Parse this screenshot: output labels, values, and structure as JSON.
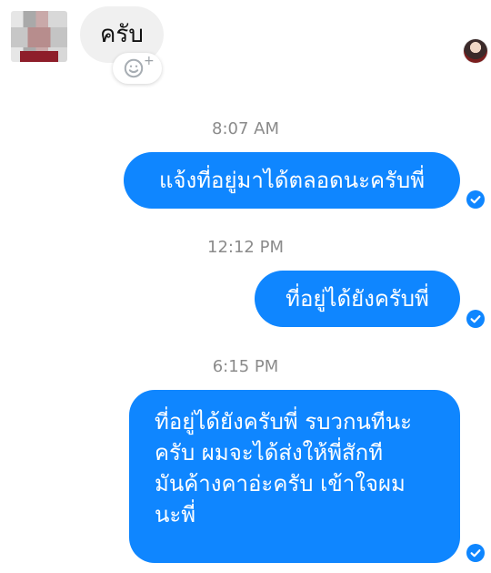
{
  "conversation": {
    "incoming_message": "ครับ",
    "messages": [
      {
        "time": "8:07 AM",
        "text": "แจ้งที่อยู่มาได้ตลอดนะครับพี่"
      },
      {
        "time": "12:12 PM",
        "text": "ที่อยู่ได้ยังครับพี่"
      },
      {
        "time": "6:15 PM",
        "lines": [
          "ที่อยู่ได้ยังครับพี่ รบวกนทีนะ",
          "ครับ ผมจะได้ส่งให้พี่สักที",
          "มันค้างคาอ่ะครับ เข้าใจผม",
          "นะพี่"
        ]
      }
    ]
  },
  "colors": {
    "outgoing_bubble": "#0f86ff",
    "incoming_bubble": "#f0f0f0",
    "timestamp": "#8b8b8b"
  },
  "icons": {
    "reaction": "smiley-plus-icon",
    "read_receipt": "check-circle-icon"
  }
}
